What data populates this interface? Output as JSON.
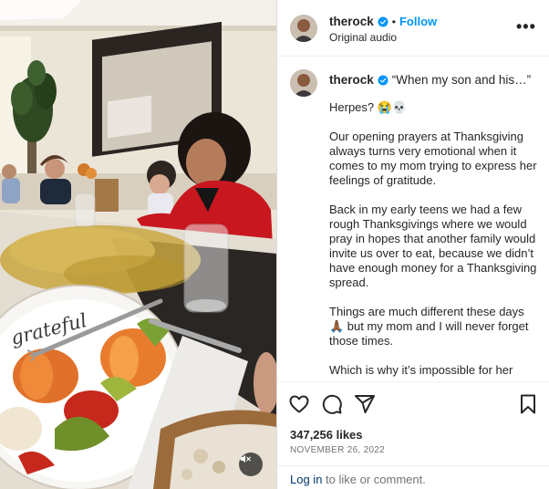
{
  "post": {
    "username": "therock",
    "follow_label": "Follow",
    "separator": "•",
    "audio": "Original audio",
    "more_label": "•••",
    "caption_title": "“When my son and his…”",
    "caption_paragraphs": [
      "Herpes? 😭💀",
      "Our opening prayers at Thanksgiving always turns very emotional when it comes to my mom trying to express her feelings of gratitude.",
      "Back in my early teens we had a few rough Thanksgivings where we would pray in hopes that another family would invite us over to eat, because we didn’t have enough money for a Thanksgiving spread.",
      "Things are much different these days 🙏🏾 but my mom and I will never forget those times.",
      "Which is why it’s impossible for her"
    ],
    "likes": "347,256 likes",
    "date": "NOVEMBER 26, 2022",
    "login_link": "Log in",
    "login_rest": " to like or comment.",
    "plate_text": "grateful"
  },
  "colors": {
    "accent": "#0095f6",
    "verified": "#0095f6",
    "link_dark": "#00376b",
    "muted": "#737373"
  },
  "icons": [
    "heart-icon",
    "comment-icon",
    "share-icon",
    "bookmark-icon",
    "verified-badge-icon",
    "mute-icon",
    "more-options-icon"
  ]
}
